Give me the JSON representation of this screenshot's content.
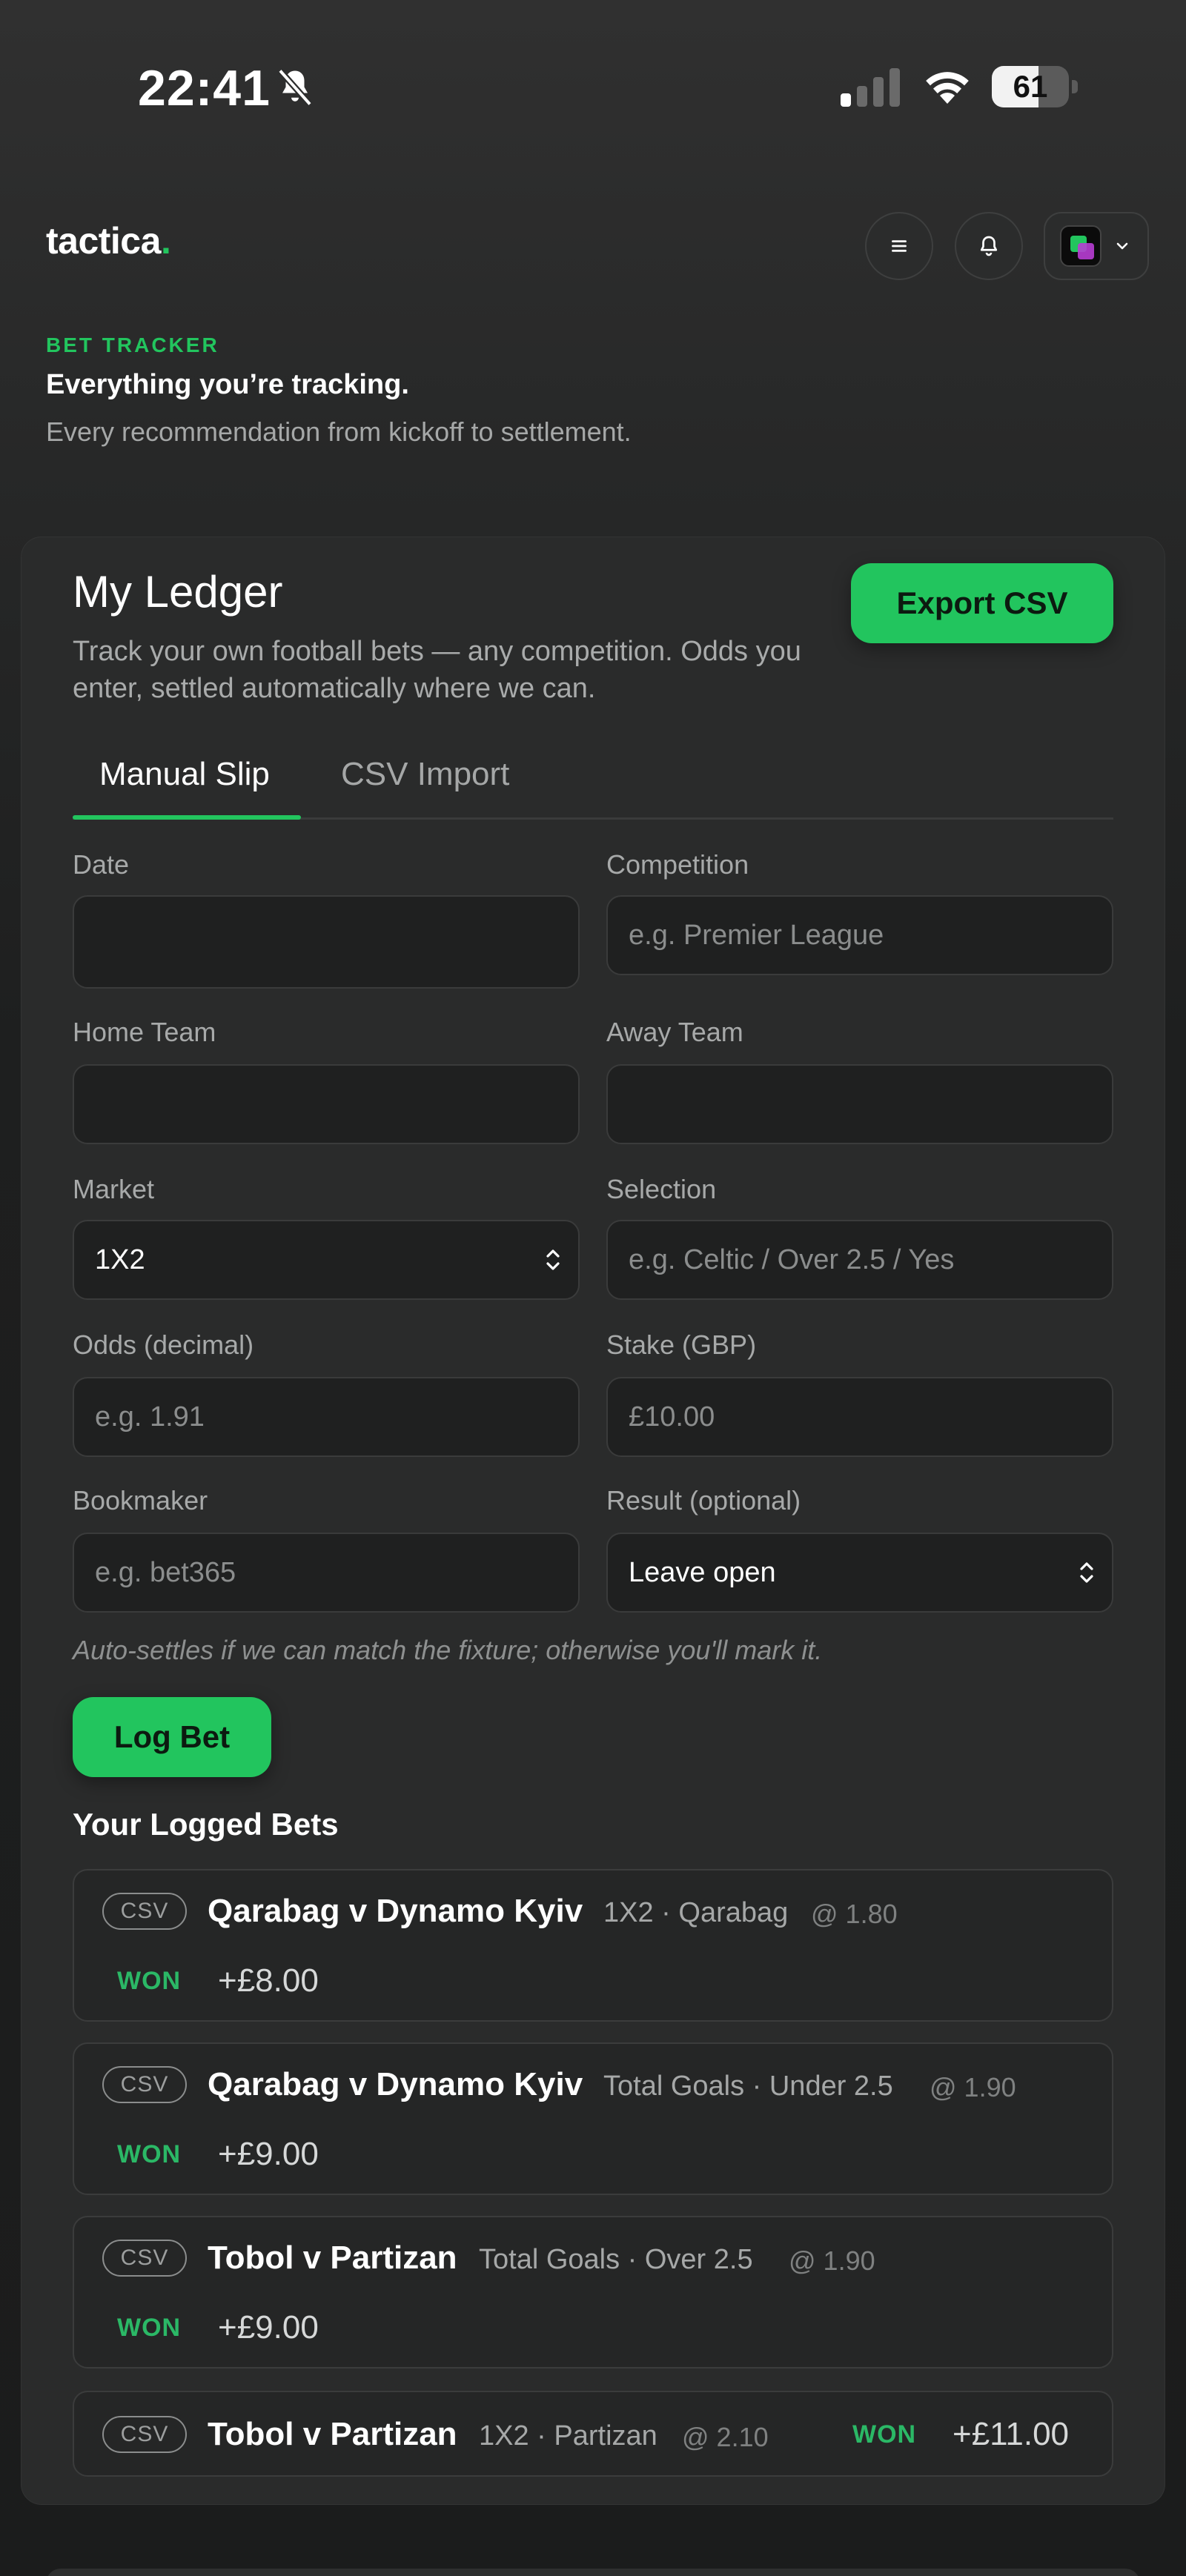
{
  "status_bar": {
    "time": "22:41",
    "battery_level": "61",
    "battery_fraction": 0.61,
    "silent_icon": "bell-slash-icon",
    "signal_icon": "cellular-signal-icon",
    "wifi_icon": "wifi-icon"
  },
  "header": {
    "logo_text": "tactica",
    "logo_dot": ".",
    "menu_icon": "hamburger-menu-icon",
    "notifications_icon": "bell-icon",
    "account_icon": "avatar-icon"
  },
  "hero": {
    "eyebrow": "BET TRACKER",
    "title": "Everything you’re tracking.",
    "subtitle": "Every recommendation from kickoff to settlement."
  },
  "ledger": {
    "title": "My Ledger",
    "description": "Track your own football bets — any competition. Odds you enter, settled automatically where we can.",
    "export_label": "Export CSV",
    "tabs": [
      {
        "label": "Manual Slip",
        "active": true
      },
      {
        "label": "CSV Import",
        "active": false
      }
    ]
  },
  "form": {
    "date": {
      "label": "Date",
      "value": "",
      "placeholder": ""
    },
    "competition": {
      "label": "Competition",
      "value": "",
      "placeholder": "e.g. Premier League"
    },
    "home_team": {
      "label": "Home Team",
      "value": "",
      "placeholder": ""
    },
    "away_team": {
      "label": "Away Team",
      "value": "",
      "placeholder": ""
    },
    "market": {
      "label": "Market",
      "value": "1X2"
    },
    "selection": {
      "label": "Selection",
      "value": "",
      "placeholder": "e.g. Celtic / Over 2.5 / Yes"
    },
    "odds": {
      "label": "Odds (decimal)",
      "value": "",
      "placeholder": "e.g. 1.91"
    },
    "stake": {
      "label": "Stake (GBP)",
      "value": "",
      "placeholder": "£10.00"
    },
    "bookmaker": {
      "label": "Bookmaker",
      "value": "",
      "placeholder": "e.g. bet365"
    },
    "result": {
      "label": "Result (optional)",
      "value": "Leave open"
    },
    "hint": "Auto-settles if we can match the fixture; otherwise you'll mark it.",
    "submit_label": "Log Bet"
  },
  "bets": {
    "heading": "Your Logged Bets",
    "items": [
      {
        "source": "CSV",
        "match": "Qarabag v Dynamo Kyiv",
        "meta": "1X2 · Qarabag",
        "odds": "@ 1.80",
        "result": "WON",
        "pnl": "+£8.00"
      },
      {
        "source": "CSV",
        "match": "Qarabag v Dynamo Kyiv",
        "meta": "Total Goals · Under 2.5",
        "odds": "@ 1.90",
        "result": "WON",
        "pnl": "+£9.00"
      },
      {
        "source": "CSV",
        "match": "Tobol v Partizan",
        "meta": "Total Goals · Over 2.5",
        "odds": "@ 1.90",
        "result": "WON",
        "pnl": "+£9.00"
      },
      {
        "source": "CSV",
        "match": "Tobol v Partizan",
        "meta": "1X2 · Partizan",
        "odds": "@ 2.10",
        "result": "WON",
        "pnl": "+£11.00"
      }
    ]
  },
  "colors": {
    "accent": "#22c55e",
    "won": "#2bb866",
    "background": "#1d1e1e",
    "card": "#2a2b2b"
  }
}
